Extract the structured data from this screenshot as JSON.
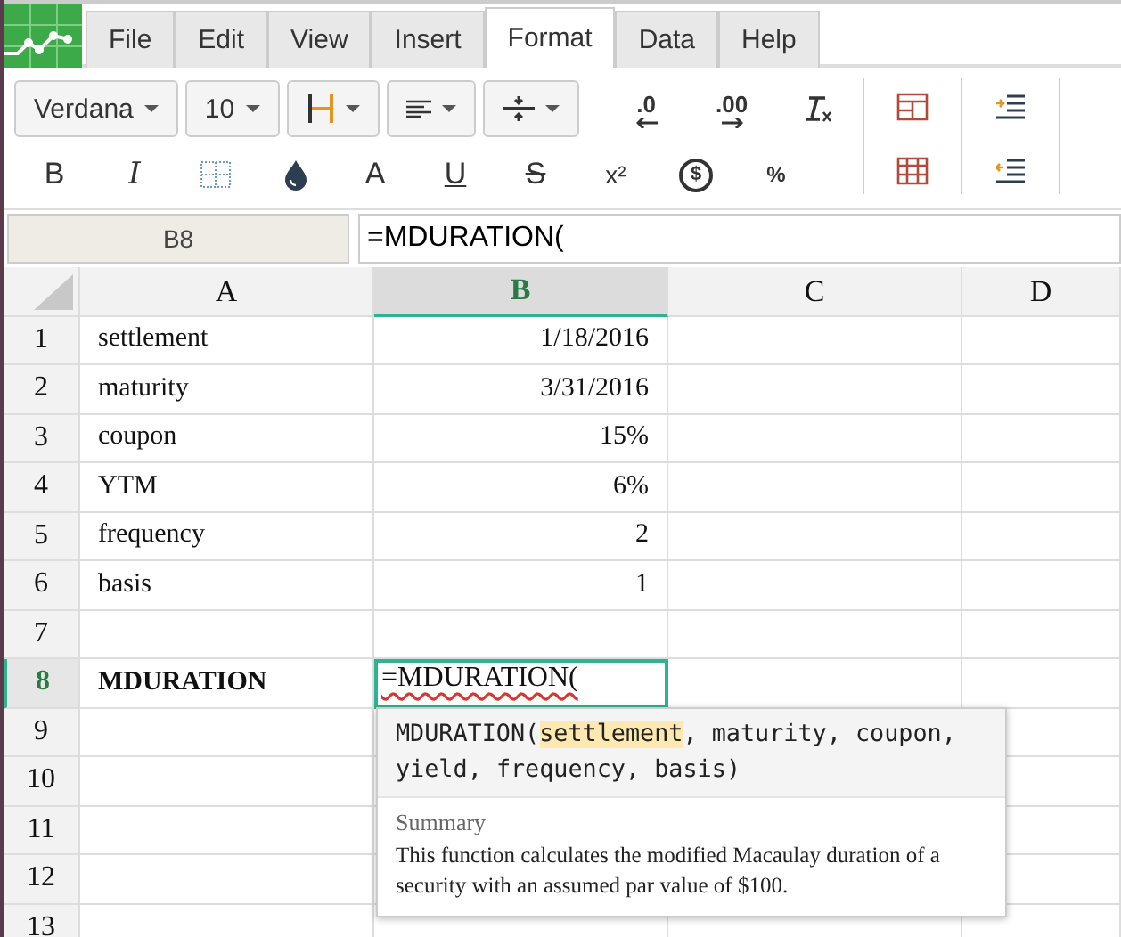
{
  "menu": {
    "tabs": [
      {
        "label": "File",
        "selected": false
      },
      {
        "label": "Edit",
        "selected": false
      },
      {
        "label": "View",
        "selected": false
      },
      {
        "label": "Insert",
        "selected": false
      },
      {
        "label": "Format",
        "selected": true
      },
      {
        "label": "Data",
        "selected": false
      },
      {
        "label": "Help",
        "selected": false
      }
    ]
  },
  "toolbar": {
    "row1": [
      {
        "kind": "dropdown",
        "label": "Verdana"
      },
      {
        "kind": "dropdown",
        "label": "10"
      },
      {
        "kind": "borders-dropdown"
      },
      {
        "kind": "align-dropdown"
      },
      {
        "kind": "valign-dropdown"
      },
      {
        "kind": "decrease-decimal",
        "glyph": ".0"
      },
      {
        "kind": "increase-decimal",
        "glyph": ".00"
      },
      {
        "kind": "clear-format"
      }
    ],
    "row2": [
      {
        "kind": "bold",
        "glyph": "B"
      },
      {
        "kind": "italic",
        "glyph": "I"
      },
      {
        "kind": "borders"
      },
      {
        "kind": "fill"
      },
      {
        "kind": "text-color",
        "glyph": "A"
      },
      {
        "kind": "underline",
        "glyph": "U"
      },
      {
        "kind": "strike",
        "glyph": "S"
      },
      {
        "kind": "superscript",
        "glyph": "x²"
      },
      {
        "kind": "currency",
        "glyph": "$"
      },
      {
        "kind": "percent",
        "glyph": "%"
      }
    ],
    "group2": [
      {
        "kind": "merge"
      },
      {
        "kind": "unmerge"
      }
    ],
    "group3": [
      {
        "kind": "indent"
      },
      {
        "kind": "outdent"
      }
    ]
  },
  "formula_bar": {
    "name_box": "B8",
    "formula": "=MDURATION("
  },
  "sheet": {
    "columns": [
      {
        "label": "A",
        "selected": false
      },
      {
        "label": "B",
        "selected": true
      },
      {
        "label": "C",
        "selected": false
      },
      {
        "label": "D",
        "selected": false
      }
    ],
    "rows": [
      {
        "header": "1",
        "selected": false,
        "cells": [
          {
            "text": "settlement",
            "kind": "text"
          },
          {
            "text": "1/18/2016",
            "kind": "number"
          }
        ]
      },
      {
        "header": "2",
        "selected": false,
        "cells": [
          {
            "text": "maturity",
            "kind": "text"
          },
          {
            "text": "3/31/2016",
            "kind": "number"
          }
        ]
      },
      {
        "header": "3",
        "selected": false,
        "cells": [
          {
            "text": "coupon",
            "kind": "text"
          },
          {
            "text": "15%",
            "kind": "number"
          }
        ]
      },
      {
        "header": "4",
        "selected": false,
        "cells": [
          {
            "text": "YTM",
            "kind": "text"
          },
          {
            "text": "6%",
            "kind": "number"
          }
        ]
      },
      {
        "header": "5",
        "selected": false,
        "cells": [
          {
            "text": "frequency",
            "kind": "text"
          },
          {
            "text": "2",
            "kind": "number"
          }
        ]
      },
      {
        "header": "6",
        "selected": false,
        "cells": [
          {
            "text": "basis",
            "kind": "text"
          },
          {
            "text": "1",
            "kind": "number"
          }
        ]
      },
      {
        "header": "7",
        "selected": false,
        "cells": []
      },
      {
        "header": "8",
        "selected": true,
        "cells": [
          {
            "text": "MDURATION",
            "kind": "bold"
          },
          {
            "text": "=MDURATION(",
            "kind": "editing"
          }
        ]
      },
      {
        "header": "9",
        "selected": false,
        "cells": []
      },
      {
        "header": "10",
        "selected": false,
        "cells": []
      },
      {
        "header": "11",
        "selected": false,
        "cells": []
      },
      {
        "header": "12",
        "selected": false,
        "cells": []
      },
      {
        "header": "13",
        "selected": false,
        "cells": []
      }
    ]
  },
  "tooltip": {
    "function": "MDURATION(",
    "params": [
      {
        "name": "settlement",
        "selected": true
      },
      {
        "name": "maturity",
        "selected": false
      },
      {
        "name": "coupon",
        "selected": false
      },
      {
        "name": "yield",
        "selected": false
      },
      {
        "name": "frequency",
        "selected": false
      },
      {
        "name": "basis",
        "selected": false
      }
    ],
    "separator": ", ",
    "close": ")",
    "summary_label": "Summary",
    "description": "This function calculates the modified Macaulay duration of a security with an assumed par value of $100."
  }
}
